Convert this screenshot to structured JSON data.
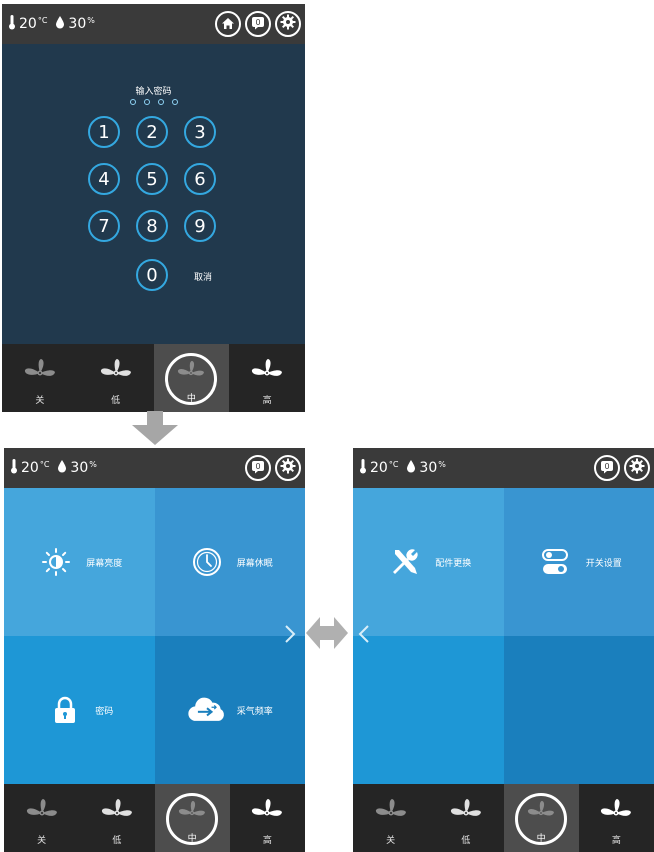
{
  "screens": {
    "keypad": {
      "status": {
        "temp": "20",
        "temp_unit": "°C",
        "humidity": "30",
        "humidity_unit": "%"
      },
      "title": "输入密码",
      "keys": [
        "1",
        "2",
        "3",
        "4",
        "5",
        "6",
        "7",
        "8",
        "9",
        "0"
      ],
      "cancel_label": "取消"
    },
    "menu1": {
      "status": {
        "temp": "20",
        "temp_unit": "°C",
        "humidity": "30",
        "humidity_unit": "%"
      },
      "tiles": [
        {
          "label": "屏幕亮度",
          "icon": "brightness-icon",
          "color": "#45a6dc"
        },
        {
          "label": "屏幕休眠",
          "icon": "clock-icon",
          "color": "#3995d1"
        },
        {
          "label": "密码",
          "icon": "lock-icon",
          "color": "#1e97d6"
        },
        {
          "label": "采气频率",
          "icon": "cloud-arrow-icon",
          "color": "#1a7fbd"
        }
      ]
    },
    "menu2": {
      "status": {
        "temp": "20",
        "temp_unit": "°C",
        "humidity": "30",
        "humidity_unit": "%"
      },
      "tiles": [
        {
          "label": "配件更换",
          "icon": "tools-icon",
          "color": "#45a6dc"
        },
        {
          "label": "开关设置",
          "icon": "toggle-icon",
          "color": "#3995d1"
        },
        {
          "label": "",
          "icon": "",
          "color": "#1e97d6"
        },
        {
          "label": "",
          "icon": "",
          "color": "#1a7fbd"
        }
      ]
    }
  },
  "fan_modes": [
    "关",
    "低",
    "中",
    "高"
  ],
  "active_fan_mode": "中",
  "colors": {
    "status_bar": "#3a3a3a",
    "keypad_bg": "#21394d",
    "key_ring": "#34a8e0",
    "fan_bar": "#252525"
  }
}
